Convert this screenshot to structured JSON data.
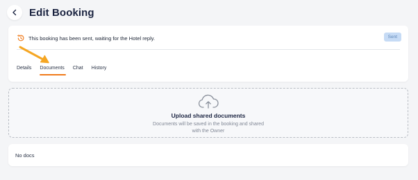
{
  "header": {
    "back_icon": "chevron-left-icon",
    "title": "Edit Booking"
  },
  "status": {
    "icon": "history-icon",
    "message": "This booking has been sent, waiting for the Hotel reply.",
    "badge": "Sent"
  },
  "tabs": [
    {
      "label": "Details",
      "active": false
    },
    {
      "label": "Documents",
      "active": true
    },
    {
      "label": "Chat",
      "active": false
    },
    {
      "label": "History",
      "active": false
    }
  ],
  "upload": {
    "icon": "cloud-upload-icon",
    "title": "Upload shared documents",
    "description": "Documents will be saved in the booking and shared with the Owner"
  },
  "documents": {
    "empty_text": "No docs"
  },
  "colors": {
    "accent": "#f07a1a",
    "arrow": "#f5a623",
    "badge_bg": "#c6dbf5"
  }
}
